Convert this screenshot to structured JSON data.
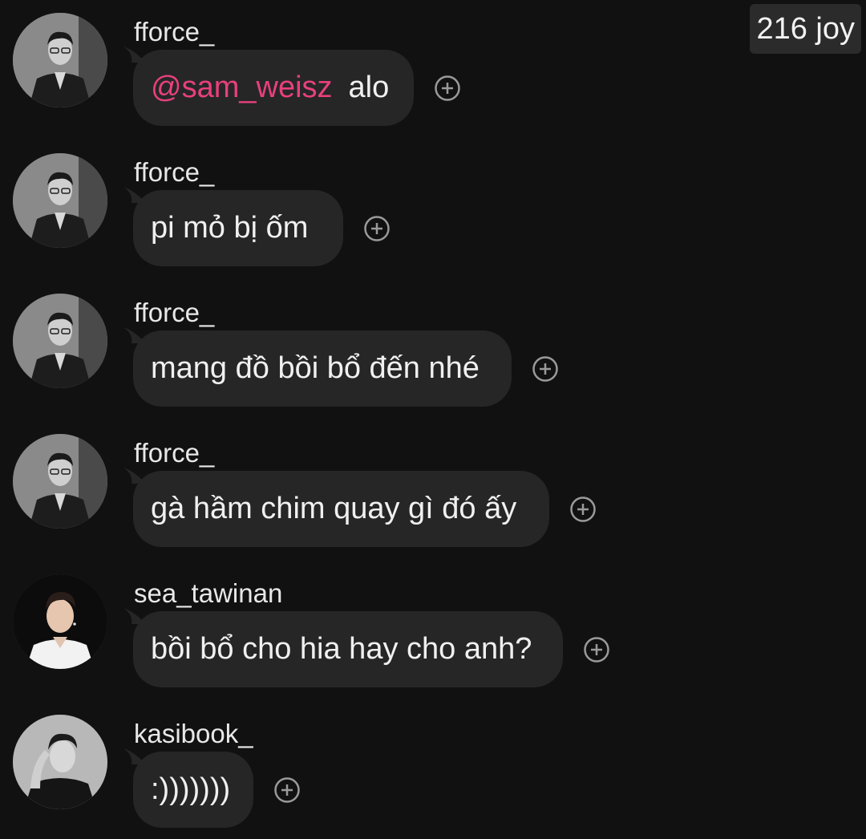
{
  "badge": {
    "text": "216 joy"
  },
  "messages": [
    {
      "username": "fforce_",
      "mention": "@sam_weisz",
      "text": "alo",
      "avatar": "avatar-fforce"
    },
    {
      "username": "fforce_",
      "text": "pi mỏ bị ốm",
      "avatar": "avatar-fforce"
    },
    {
      "username": "fforce_",
      "text": "mang đồ bồi bổ đến nhé",
      "avatar": "avatar-fforce"
    },
    {
      "username": "fforce_",
      "text": "gà hầm chim quay gì đó ấy",
      "avatar": "avatar-fforce"
    },
    {
      "username": "sea_tawinan",
      "text": "bồi bổ cho hia hay cho anh?",
      "avatar": "avatar-sea"
    },
    {
      "username": "kasibook_",
      "text": ":)))))))",
      "avatar": "avatar-kasibook"
    }
  ],
  "icons": {
    "react": "plus-circle-icon"
  },
  "colors": {
    "background": "#111111",
    "bubble": "#262626",
    "mention": "#e8407c",
    "text": "#f0f0f0"
  }
}
